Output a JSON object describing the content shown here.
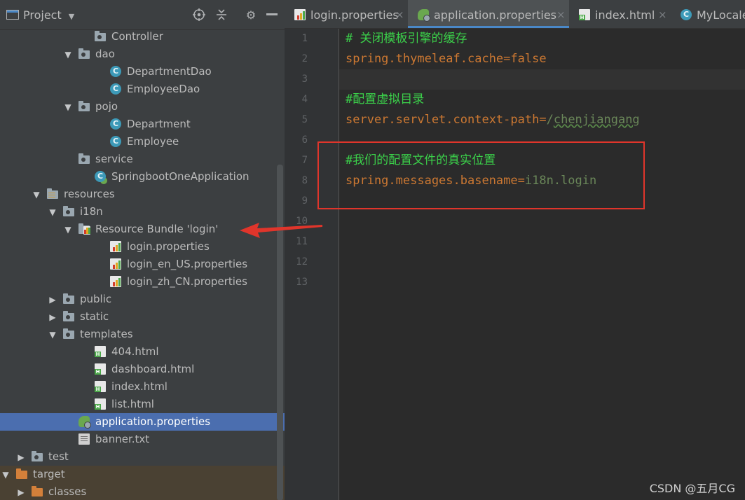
{
  "project_panel": {
    "title": "Project",
    "tree": [
      {
        "label": "Controller",
        "icon": "folder-icon",
        "expanded": null
      },
      {
        "label": "dao",
        "icon": "folder-icon",
        "expanded": true
      },
      {
        "label": "DepartmentDao",
        "icon": "class-icon",
        "expanded": null
      },
      {
        "label": "EmployeeDao",
        "icon": "class-icon",
        "expanded": null
      },
      {
        "label": "pojo",
        "icon": "folder-icon",
        "expanded": true
      },
      {
        "label": "Department",
        "icon": "class-icon",
        "expanded": null
      },
      {
        "label": "Employee",
        "icon": "class-icon",
        "expanded": null
      },
      {
        "label": "service",
        "icon": "folder-icon",
        "expanded": null
      },
      {
        "label": "SpringbootOneApplication",
        "icon": "spring-class-icon",
        "expanded": null
      },
      {
        "label": "resources",
        "icon": "resources-folder-icon",
        "expanded": true
      },
      {
        "label": "i18n",
        "icon": "folder-icon",
        "expanded": true
      },
      {
        "label": "Resource Bundle 'login'",
        "icon": "resource-bundle-icon",
        "expanded": true
      },
      {
        "label": "login.properties",
        "icon": "properties-file-icon",
        "expanded": null
      },
      {
        "label": "login_en_US.properties",
        "icon": "properties-file-icon",
        "expanded": null
      },
      {
        "label": "login_zh_CN.properties",
        "icon": "properties-file-icon",
        "expanded": null
      },
      {
        "label": "public",
        "icon": "folder-icon",
        "expanded": false
      },
      {
        "label": "static",
        "icon": "folder-icon",
        "expanded": false
      },
      {
        "label": "templates",
        "icon": "folder-icon",
        "expanded": true
      },
      {
        "label": "404.html",
        "icon": "html-file-icon",
        "expanded": null
      },
      {
        "label": "dashboard.html",
        "icon": "html-file-icon",
        "expanded": null
      },
      {
        "label": "index.html",
        "icon": "html-file-icon",
        "expanded": null
      },
      {
        "label": "list.html",
        "icon": "html-file-icon",
        "expanded": null
      },
      {
        "label": "application.properties",
        "icon": "spring-properties-icon",
        "expanded": null,
        "selected": true
      },
      {
        "label": "banner.txt",
        "icon": "text-file-icon",
        "expanded": null
      },
      {
        "label": "test",
        "icon": "folder-icon",
        "expanded": false
      },
      {
        "label": "target",
        "icon": "orange-folder-icon",
        "expanded": true
      },
      {
        "label": "classes",
        "icon": "orange-folder-icon",
        "expanded": false
      }
    ]
  },
  "tabs": [
    {
      "label": "login.properties",
      "icon": "properties-file-icon",
      "active": false
    },
    {
      "label": "application.properties",
      "icon": "spring-properties-icon",
      "active": true
    },
    {
      "label": "index.html",
      "icon": "html-file-icon",
      "active": false
    },
    {
      "label": "MyLocaleR",
      "icon": "class-icon",
      "active": false
    }
  ],
  "tab_close_glyph": "×",
  "editor": {
    "line_numbers": [
      "1",
      "2",
      "3",
      "4",
      "5",
      "6",
      "7",
      "8",
      "9",
      "10",
      "11",
      "12",
      "13"
    ],
    "lines": {
      "l1": {
        "comment": "# 关闭模板引擎的缓存"
      },
      "l2": {
        "key": "spring.thymeleaf.cache",
        "eq": "=",
        "value": "false"
      },
      "l4": {
        "comment": "#配置虚拟目录"
      },
      "l5": {
        "key": "server.servlet.context-path",
        "eq": "=",
        "value_prefix": "/",
        "value": "chenjiangang"
      },
      "l7": {
        "comment": "#我们的配置文件的真实位置"
      },
      "l8": {
        "key": "spring.messages.basename",
        "eq": "=",
        "value": "i18n.login"
      }
    },
    "current_line": 3
  },
  "watermark": "CSDN @五月CG",
  "colors": {
    "selection": "#4b6eaf",
    "annotation_red": "#e0352b",
    "comment_green": "#3bd04a",
    "key_orange": "#cc7832"
  }
}
